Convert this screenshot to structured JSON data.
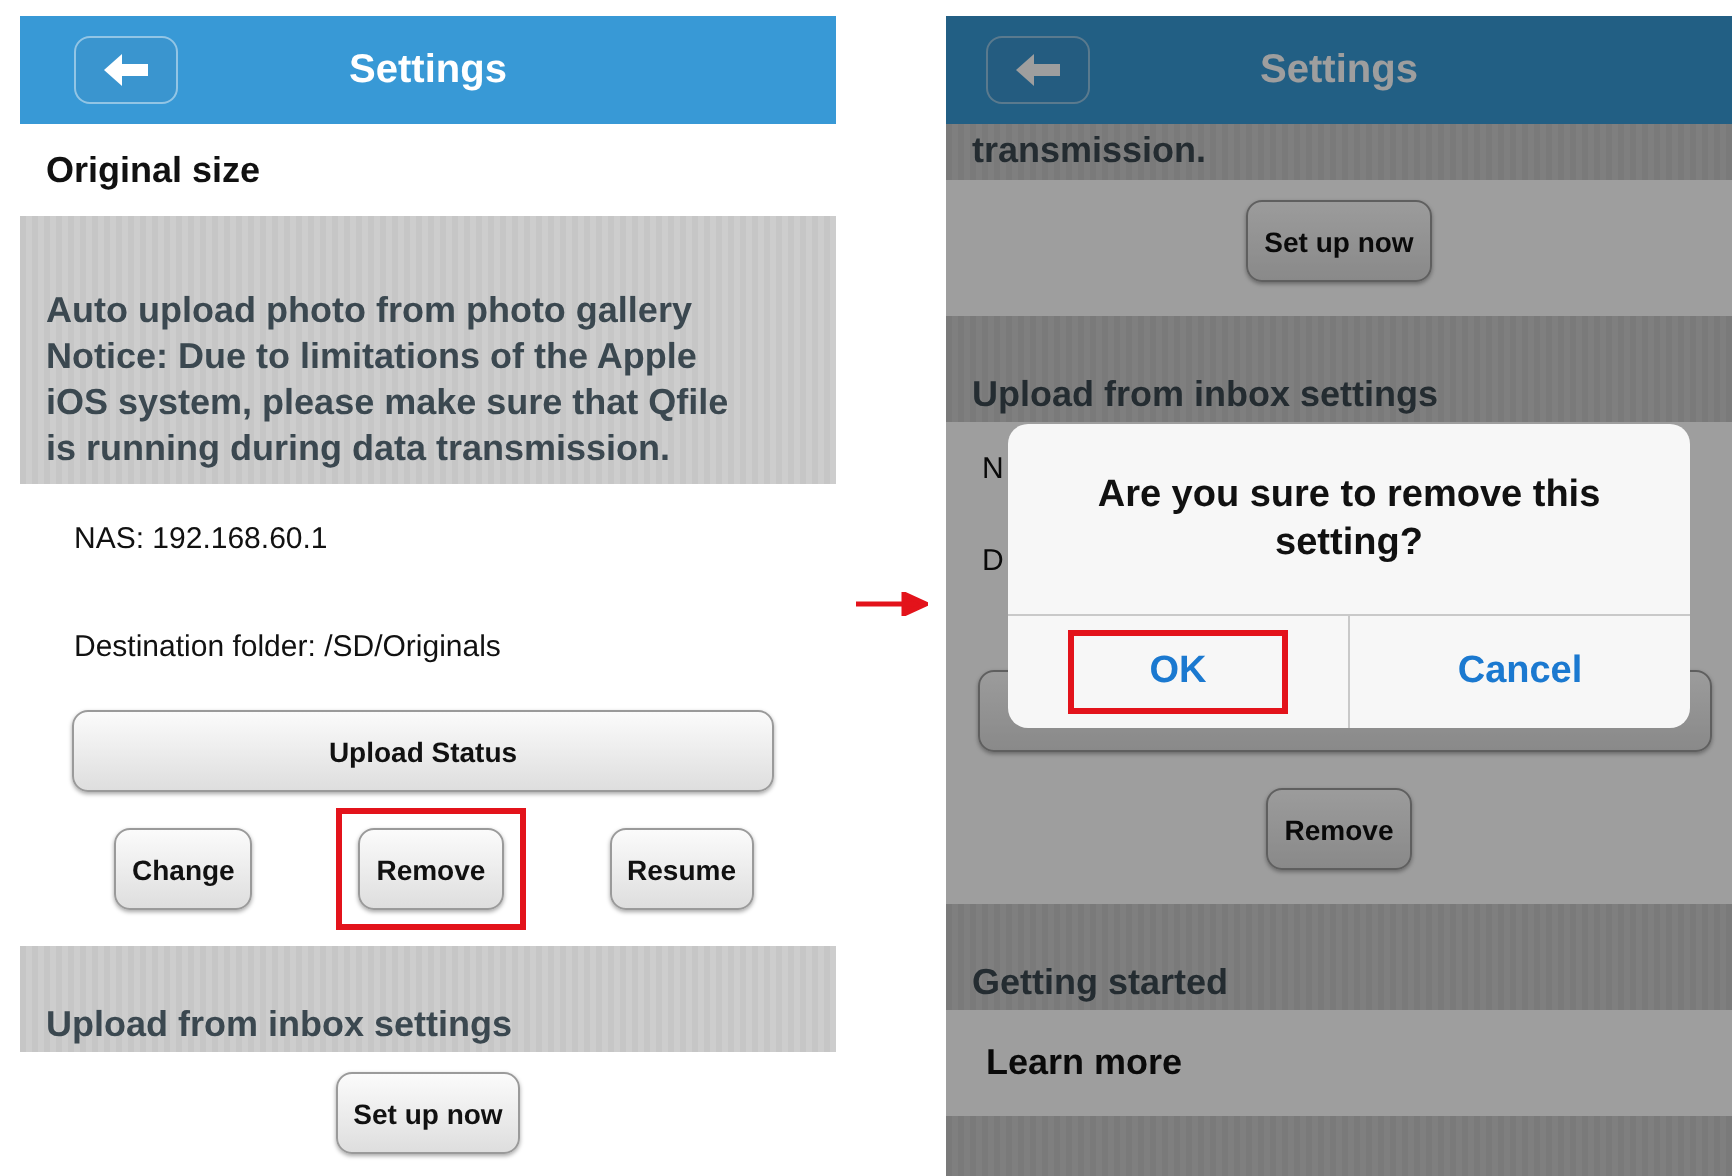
{
  "screens": [
    {
      "dimmed": false,
      "header": {
        "title": "Settings"
      },
      "items": [
        {
          "kind": "row",
          "text": "Original size"
        },
        {
          "kind": "band",
          "text": "Auto upload photo from photo gallery Notice: Due to limitations of the Apple iOS system, please make sure that Qfile is running during data transmission.",
          "tall": true
        },
        {
          "kind": "label",
          "text": "NAS: 192.168.60.1"
        },
        {
          "kind": "label",
          "text": "Destination folder: /SD/Originals"
        },
        {
          "kind": "wide_button",
          "label": "Upload Status"
        },
        {
          "kind": "buttons",
          "buttons": [
            {
              "label": "Change",
              "highlighted": false
            },
            {
              "label": "Remove",
              "highlighted": true
            },
            {
              "label": "Resume",
              "highlighted": false
            }
          ]
        },
        {
          "kind": "band",
          "text": "Upload from inbox settings",
          "tall": false
        },
        {
          "kind": "center_button",
          "label": "Set up now",
          "highlighted": false
        }
      ]
    },
    {
      "dimmed": true,
      "header": {
        "title": "Settings"
      },
      "items": [
        {
          "kind": "top_band",
          "text": "transmission."
        },
        {
          "kind": "center_button",
          "label": "Set up now",
          "highlighted": false
        },
        {
          "kind": "band",
          "text": "Upload from inbox settings",
          "tall": false
        },
        {
          "kind": "label",
          "text": "N"
        },
        {
          "kind": "label",
          "text": "D"
        },
        {
          "kind": "wide_button"
        },
        {
          "kind": "center_button",
          "label": "Remove",
          "highlighted": false
        },
        {
          "kind": "band",
          "text": "Getting started",
          "tall": false
        },
        {
          "kind": "row",
          "text": "Learn more"
        },
        {
          "kind": "stripe"
        }
      ],
      "dialog": {
        "message": "Are you sure to remove this setting?",
        "buttons": [
          {
            "label": "OK",
            "highlighted": true
          },
          {
            "label": "Cancel",
            "highlighted": false
          }
        ]
      }
    }
  ]
}
